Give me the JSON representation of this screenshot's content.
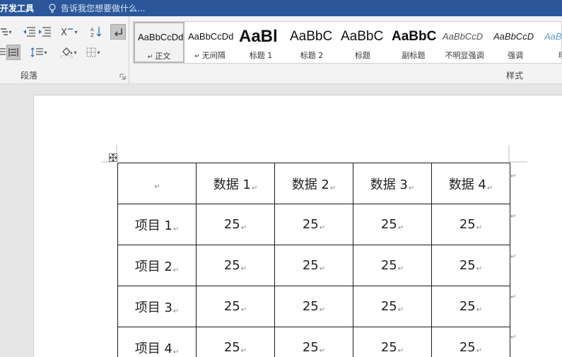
{
  "titlebar": {
    "dev_tab": "开发工具",
    "tell_me": "告诉我您想要做什么..."
  },
  "ribbon": {
    "paragraph_group_label": "段落",
    "styles_group_label": "样式",
    "styles": [
      {
        "sample": "AaBbCcDd",
        "label": "正文",
        "selected": true
      },
      {
        "sample": "AaBbCcDd",
        "label": "无间隔",
        "selected": false
      },
      {
        "sample": "AaBl",
        "label": "标题 1",
        "selected": false
      },
      {
        "sample": "AaBbC",
        "label": "标题 2",
        "selected": false
      },
      {
        "sample": "AaBbC",
        "label": "标题",
        "selected": false
      },
      {
        "sample": "AaBbC",
        "label": "副标题",
        "selected": false
      },
      {
        "sample": "AaBbCcD",
        "label": "不明显强调",
        "selected": false
      },
      {
        "sample": "AaBbCcD",
        "label": "强调",
        "selected": false
      },
      {
        "sample": "AaBb",
        "label": "明显",
        "selected": false
      }
    ]
  },
  "table": {
    "header": [
      "",
      "数据 1",
      "数据 2",
      "数据 3",
      "数据 4"
    ],
    "rows": [
      [
        "项目 1",
        "25",
        "25",
        "25",
        "25"
      ],
      [
        "项目 2",
        "25",
        "25",
        "25",
        "25"
      ],
      [
        "项目 3",
        "25",
        "25",
        "25",
        "25"
      ],
      [
        "项目 4",
        "25",
        "25",
        "25",
        "25"
      ]
    ],
    "return_mark": "↵"
  },
  "colors": {
    "titlebar": "#2b579a",
    "ribbon": "#f3f3f3",
    "page": "#ffffff"
  }
}
